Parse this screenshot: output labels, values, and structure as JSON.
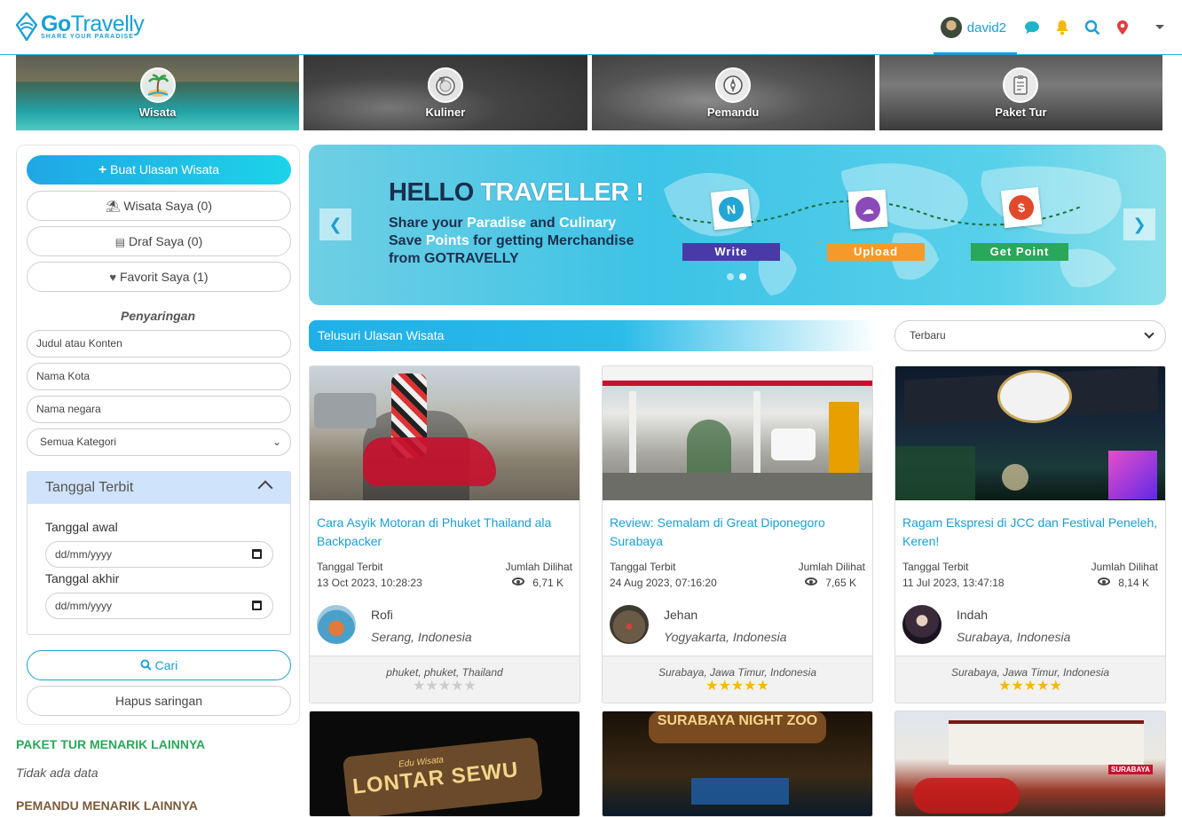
{
  "brand": {
    "name_bold": "Go",
    "name_light": "Travelly",
    "tagline": "SHARE YOUR PARADISE"
  },
  "nav": {
    "username": "david2",
    "icons": [
      "chat-icon",
      "bell-icon",
      "search-icon",
      "location-pin-icon",
      "caret-down-icon"
    ]
  },
  "categories": [
    {
      "label": "Wisata",
      "icon": "palm-island-icon"
    },
    {
      "label": "Kuliner",
      "icon": "plate-icon"
    },
    {
      "label": "Pemandu",
      "icon": "compass-icon"
    },
    {
      "label": "Paket Tur",
      "icon": "clipboard-icon"
    }
  ],
  "sidebar": {
    "create_button": "Buat Ulasan Wisata",
    "my_tours": "Wisata Saya (0)",
    "drafts": "Draf Saya (0)",
    "favorites": "Favorit Saya (1)",
    "filter_title": "Penyaringan",
    "title_placeholder": "Judul atau Konten",
    "city_placeholder": "Nama Kota",
    "country_placeholder": "Nama negara",
    "category_value": "Semua Kategori",
    "date_section": "Tanggal Terbit",
    "start_label": "Tanggal awal",
    "end_label": "Tanggal akhir",
    "date_placeholder": "dd/mm/yyyy",
    "search_button": "Cari",
    "clear_button": "Hapus saringan"
  },
  "more": {
    "tour_heading": "PAKET TUR MENARIK LAINNYA",
    "tour_empty": "Tidak ada data",
    "guide_heading": "PEMANDU MENARIK LAINNYA"
  },
  "banner": {
    "hello_a": "HELLO",
    "hello_b": "TRAVELLER !",
    "line1_a": "Share your",
    "line1_b": "Paradise",
    "line1_c": "and",
    "line1_d": "Culinary",
    "line2_a": "Save",
    "line2_b": "Points",
    "line2_c": "for getting",
    "line2_d": "Merchandise",
    "line3": "from GOTRAVELLY",
    "steps": [
      {
        "label": "Write",
        "color": "#4a3aa8"
      },
      {
        "label": "Upload",
        "color": "#f59a2a"
      },
      {
        "label": "Get Point",
        "color": "#2aa85a"
      }
    ]
  },
  "browse": {
    "title": "Telusuri Ulasan Wisata",
    "sort_value": "Terbaru"
  },
  "labels": {
    "published": "Tanggal Terbit",
    "views": "Jumlah Dilihat"
  },
  "cards": [
    {
      "title": "Cara Asyik Motoran di Phuket Thailand ala Backpacker",
      "date": "13 Oct 2023, 10:28:23",
      "views": "6,71 K",
      "author": "Rofi",
      "location": "Serang, Indonesia",
      "place": "phuket, phuket, Thailand",
      "rating": 0
    },
    {
      "title": "Review: Semalam di Great Diponegoro Surabaya",
      "date": "24 Aug 2023, 07:16:20",
      "views": "7,65 K",
      "author": "Jehan",
      "location": "Yogyakarta, Indonesia",
      "place": "Surabaya, Jawa Timur, Indonesia",
      "rating": 5
    },
    {
      "title": "Ragam Ekspresi di JCC dan Festival Peneleh, Keren!",
      "date": "11 Jul 2023, 13:47:18",
      "views": "8,14 K",
      "author": "Indah",
      "location": "Surabaya, Indonesia",
      "place": "Surabaya, Jawa Timur, Indonesia",
      "rating": 5
    }
  ],
  "second_row": [
    {
      "sign": "LONTAR SEWU",
      "sub": "Edu Wisata"
    },
    {
      "sign": "SURABAYA NIGHT ZOO"
    },
    {
      "sign": "SURABAYA"
    }
  ],
  "colors": {
    "accent": "#1a9fd3",
    "green": "#2aa85a",
    "brown": "#7a5a3a",
    "star": "#f6b800"
  }
}
